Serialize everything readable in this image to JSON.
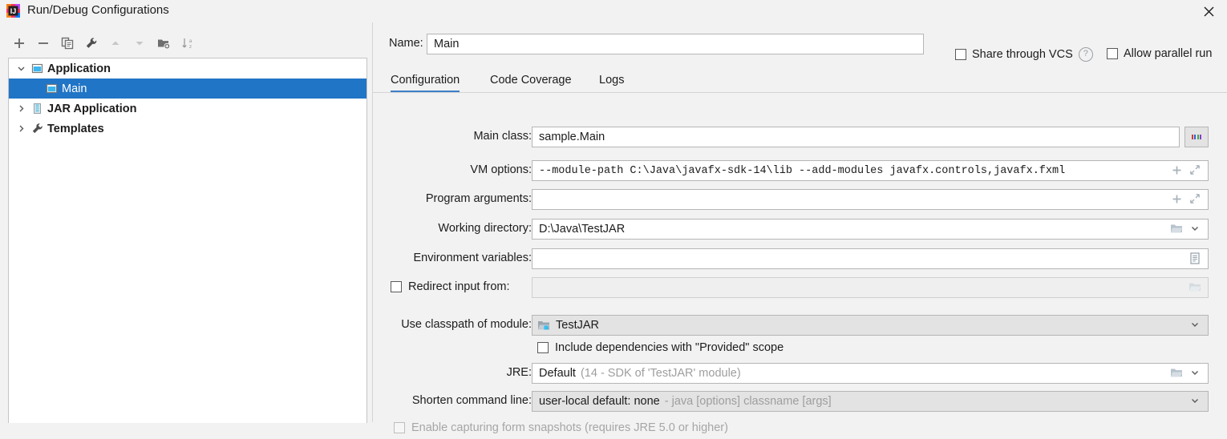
{
  "window": {
    "title": "Run/Debug Configurations",
    "app_icon": "intellij-idea-icon",
    "close_label": "✕"
  },
  "tree_toolbar": {
    "buttons": [
      {
        "name": "add-button",
        "icon": "plus-icon",
        "enabled": true
      },
      {
        "name": "remove-button",
        "icon": "minus-icon",
        "enabled": true
      },
      {
        "name": "copy-button",
        "icon": "copy-icon",
        "enabled": true
      },
      {
        "name": "edit-templates-button",
        "icon": "wrench-icon",
        "enabled": true
      },
      {
        "name": "move-up-button",
        "icon": "arrow-up-icon",
        "enabled": false
      },
      {
        "name": "move-down-button",
        "icon": "arrow-down-icon",
        "enabled": false
      },
      {
        "name": "new-folder-button",
        "icon": "new-folder-icon",
        "enabled": true
      },
      {
        "name": "sort-button",
        "icon": "sort-az-icon",
        "enabled": true
      }
    ]
  },
  "tree": {
    "items": [
      {
        "label": "Application",
        "icon": "application-icon",
        "twisty": "chevron-down-icon",
        "indent": 0,
        "selected": false,
        "bold": true
      },
      {
        "label": "Main",
        "icon": "application-icon",
        "twisty": "",
        "indent": 1,
        "selected": true,
        "bold": false
      },
      {
        "label": "JAR Application",
        "icon": "jar-icon",
        "twisty": "chevron-right-icon",
        "indent": 0,
        "selected": false,
        "bold": true
      },
      {
        "label": "Templates",
        "icon": "wrench-icon",
        "twisty": "chevron-right-icon",
        "indent": 0,
        "selected": false,
        "bold": true
      }
    ]
  },
  "header": {
    "name_label": "Name:",
    "name_value": "Main",
    "share_vcs_label": "Share through VCS",
    "share_vcs_checked": false,
    "help_icon": "question-mark-icon",
    "help_label": "?",
    "allow_parallel_label": "Allow parallel run",
    "allow_parallel_checked": false
  },
  "tabs": [
    {
      "label": "Configuration",
      "active": true
    },
    {
      "label": "Code Coverage",
      "active": false
    },
    {
      "label": "Logs",
      "active": false
    }
  ],
  "form": {
    "main_class": {
      "label": "Main class:",
      "value": "sample.Main",
      "browse_icon": "ellipsis-icon"
    },
    "vm_options": {
      "label": "VM options:",
      "value": "--module-path C:\\Java\\javafx-sdk-14\\lib --add-modules javafx.controls,javafx.fxml",
      "insert_icon": "plus-icon",
      "expand_icon": "expand-diagonal-icon"
    },
    "program_arguments": {
      "label": "Program arguments:",
      "value": "",
      "insert_icon": "plus-icon",
      "expand_icon": "expand-diagonal-icon"
    },
    "working_directory": {
      "label": "Working directory:",
      "value": "D:\\Java\\TestJAR",
      "folder_icon": "folder-icon",
      "dropdown_icon": "chevron-down-icon"
    },
    "environment_variables": {
      "label": "Environment variables:",
      "value": "",
      "editor_icon": "list-editor-icon"
    },
    "redirect_input": {
      "label": "Redirect input from:",
      "checked": false,
      "enabled": false,
      "value": "",
      "folder_icon": "folder-icon"
    },
    "use_classpath_of_module": {
      "label": "Use classpath of module:",
      "value": "TestJAR",
      "module_icon": "module-icon",
      "dropdown_icon": "chevron-down-icon"
    },
    "include_provided": {
      "label": "Include dependencies with \"Provided\" scope",
      "checked": false
    },
    "jre": {
      "label": "JRE:",
      "value": "Default",
      "value_hint": "(14 - SDK of 'TestJAR' module)",
      "folder_icon": "folder-icon",
      "dropdown_icon": "chevron-down-icon"
    },
    "shorten_command_line": {
      "label": "Shorten command line:",
      "value": "user-local default: none",
      "value_hint": "- java [options] classname [args]",
      "dropdown_icon": "chevron-down-icon"
    },
    "form_snapshots": {
      "label": "Enable capturing form snapshots (requires JRE 5.0 or higher)",
      "checked": false,
      "enabled": false
    }
  },
  "colors": {
    "selection_blue": "#2175c6",
    "tab_accent": "#3d7fc7",
    "window_bg": "#f2f2f2",
    "field_bg": "#ffffff",
    "combo_bg": "#e3e3e3",
    "border": "#b6b6b6",
    "muted_text": "#9e9e9e"
  }
}
